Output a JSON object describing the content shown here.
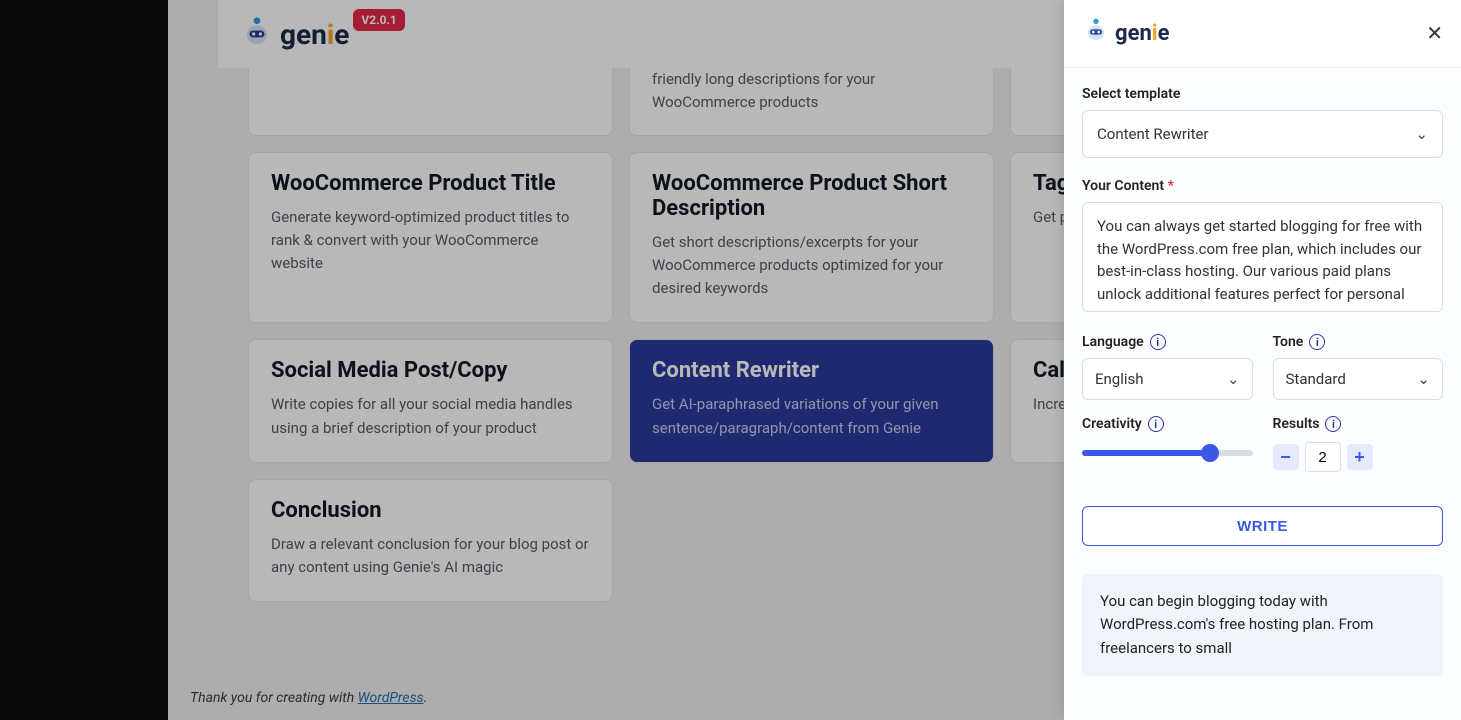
{
  "app": {
    "name": "genie",
    "version_badge": "V2.0.1"
  },
  "cards": {
    "frag_a": {
      "desc_tail": ""
    },
    "frag_b": {
      "desc_tail": "friendly long descriptions for your WooCommerce products"
    },
    "frag_c": {
      "desc_tail": ""
    },
    "woo_title": {
      "title": "WooCommerce Product Title",
      "desc": "Generate keyword-optimized product titles to rank & convert with your WooCommerce website"
    },
    "woo_short": {
      "title": "WooCommerce Product Short Description",
      "desc": "Get short descriptions/excerpts for your WooCommerce products optimized for your desired keywords"
    },
    "tag_partial": {
      "title": "Tag",
      "desc": "Get prod"
    },
    "social": {
      "title": "Social Media Post/Copy",
      "desc": "Write copies for all your social media handles using a brief description of your product"
    },
    "rewriter": {
      "title": "Content Rewriter",
      "desc": "Get AI-paraphrased variations of your given sentence/paragraph/content from Genie"
    },
    "cal_partial": {
      "title": "Cal",
      "desc": "Incre mag"
    },
    "conclusion": {
      "title": "Conclusion",
      "desc": "Draw a relevant conclusion for your blog post or any content using Genie's AI magic"
    }
  },
  "footer": {
    "prefix": "Thank you for creating with ",
    "link": "WordPress",
    "suffix": "."
  },
  "panel": {
    "select_template_label": "Select template",
    "template_value": "Content Rewriter",
    "your_content_label": "Your Content",
    "your_content_value": "You can always get started blogging for free with the WordPress.com free plan, which includes our best-in-class hosting. Our various paid plans unlock additional features perfect for personal",
    "language_label": "Language",
    "language_value": "English",
    "tone_label": "Tone",
    "tone_value": "Standard",
    "creativity_label": "Creativity",
    "results_label": "Results",
    "results_value": "2",
    "write_button": "WRITE",
    "result_text": "You can begin blogging today with WordPress.com's free hosting plan. From freelancers to small"
  }
}
